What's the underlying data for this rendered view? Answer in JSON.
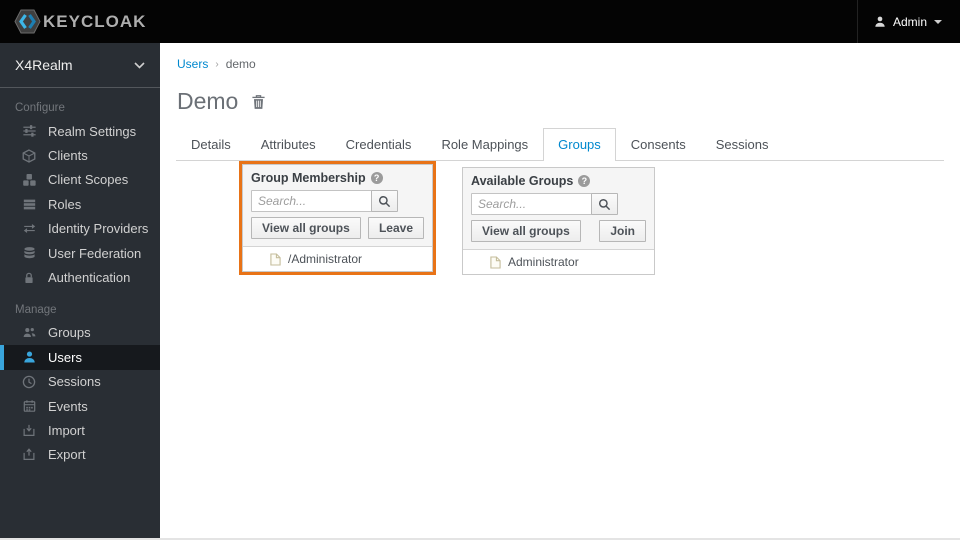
{
  "topbar": {
    "brand": "KEYCLOAK",
    "user_menu": {
      "label": "Admin"
    }
  },
  "sidebar": {
    "realm": "X4Realm",
    "sections": [
      {
        "label": "Configure",
        "items": [
          {
            "label": "Realm Settings",
            "icon": "sliders-icon"
          },
          {
            "label": "Clients",
            "icon": "cube-icon"
          },
          {
            "label": "Client Scopes",
            "icon": "cubes-icon"
          },
          {
            "label": "Roles",
            "icon": "list-icon"
          },
          {
            "label": "Identity Providers",
            "icon": "exchange-icon"
          },
          {
            "label": "User Federation",
            "icon": "database-icon"
          },
          {
            "label": "Authentication",
            "icon": "lock-icon"
          }
        ]
      },
      {
        "label": "Manage",
        "items": [
          {
            "label": "Groups",
            "icon": "group-icon",
            "active": false
          },
          {
            "label": "Users",
            "icon": "user-icon",
            "active": true
          },
          {
            "label": "Sessions",
            "icon": "clock-icon",
            "active": false
          },
          {
            "label": "Events",
            "icon": "calendar-icon",
            "active": false
          },
          {
            "label": "Import",
            "icon": "import-icon",
            "active": false
          },
          {
            "label": "Export",
            "icon": "export-icon",
            "active": false
          }
        ]
      }
    ]
  },
  "breadcrumb": {
    "link": "Users",
    "current": "demo"
  },
  "page": {
    "title": "Demo"
  },
  "tabs": {
    "items": [
      "Details",
      "Attributes",
      "Credentials",
      "Role Mappings",
      "Groups",
      "Consents",
      "Sessions"
    ],
    "active": "Groups"
  },
  "panels": {
    "group_membership": {
      "title": "Group Membership",
      "search_placeholder": "Search...",
      "view_all_label": "View all groups",
      "action_label": "Leave",
      "items": [
        "/Administrator"
      ],
      "highlighted": true
    },
    "available_groups": {
      "title": "Available Groups",
      "search_placeholder": "Search...",
      "view_all_label": "View all groups",
      "action_label": "Join",
      "items": [
        "Administrator"
      ]
    }
  },
  "colors": {
    "highlight_orange": "#e87317",
    "accent_blue": "#39a5dc",
    "link_blue": "#0088ce",
    "topbar_bg": "#040404",
    "sidebar_bg": "#292e34"
  }
}
